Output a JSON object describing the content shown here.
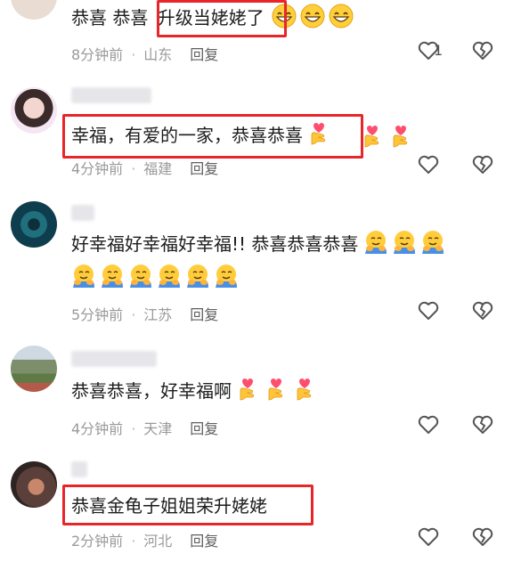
{
  "comments": [
    {
      "text_pre": "恭喜 恭喜 ",
      "text_boxed": "升级当姥姥了",
      "time": "8分钟前",
      "location": "山东",
      "reply": "回复",
      "like_count": "1",
      "emoji": "grinning-face"
    },
    {
      "text": "幸福，有爱的一家，恭喜恭喜",
      "time": "4分钟前",
      "location": "福建",
      "reply": "回复",
      "emoji": "heart-hands"
    },
    {
      "text": "好幸福好幸福好幸福!! 恭喜恭喜恭喜",
      "time": "5分钟前",
      "location": "江苏",
      "reply": "回复",
      "emoji": "hugging-face"
    },
    {
      "text": "恭喜恭喜，好幸福啊",
      "time": "4分钟前",
      "location": "天津",
      "reply": "回复",
      "emoji": "heart-hands"
    },
    {
      "text": "恭喜金龟子姐姐荣升姥姥",
      "time": "2分钟前",
      "location": "河北",
      "reply": "回复"
    }
  ],
  "colors": {
    "highlight_box": "#e8262a",
    "meta": "#9a9a9a",
    "reply": "#5f5f5f"
  }
}
